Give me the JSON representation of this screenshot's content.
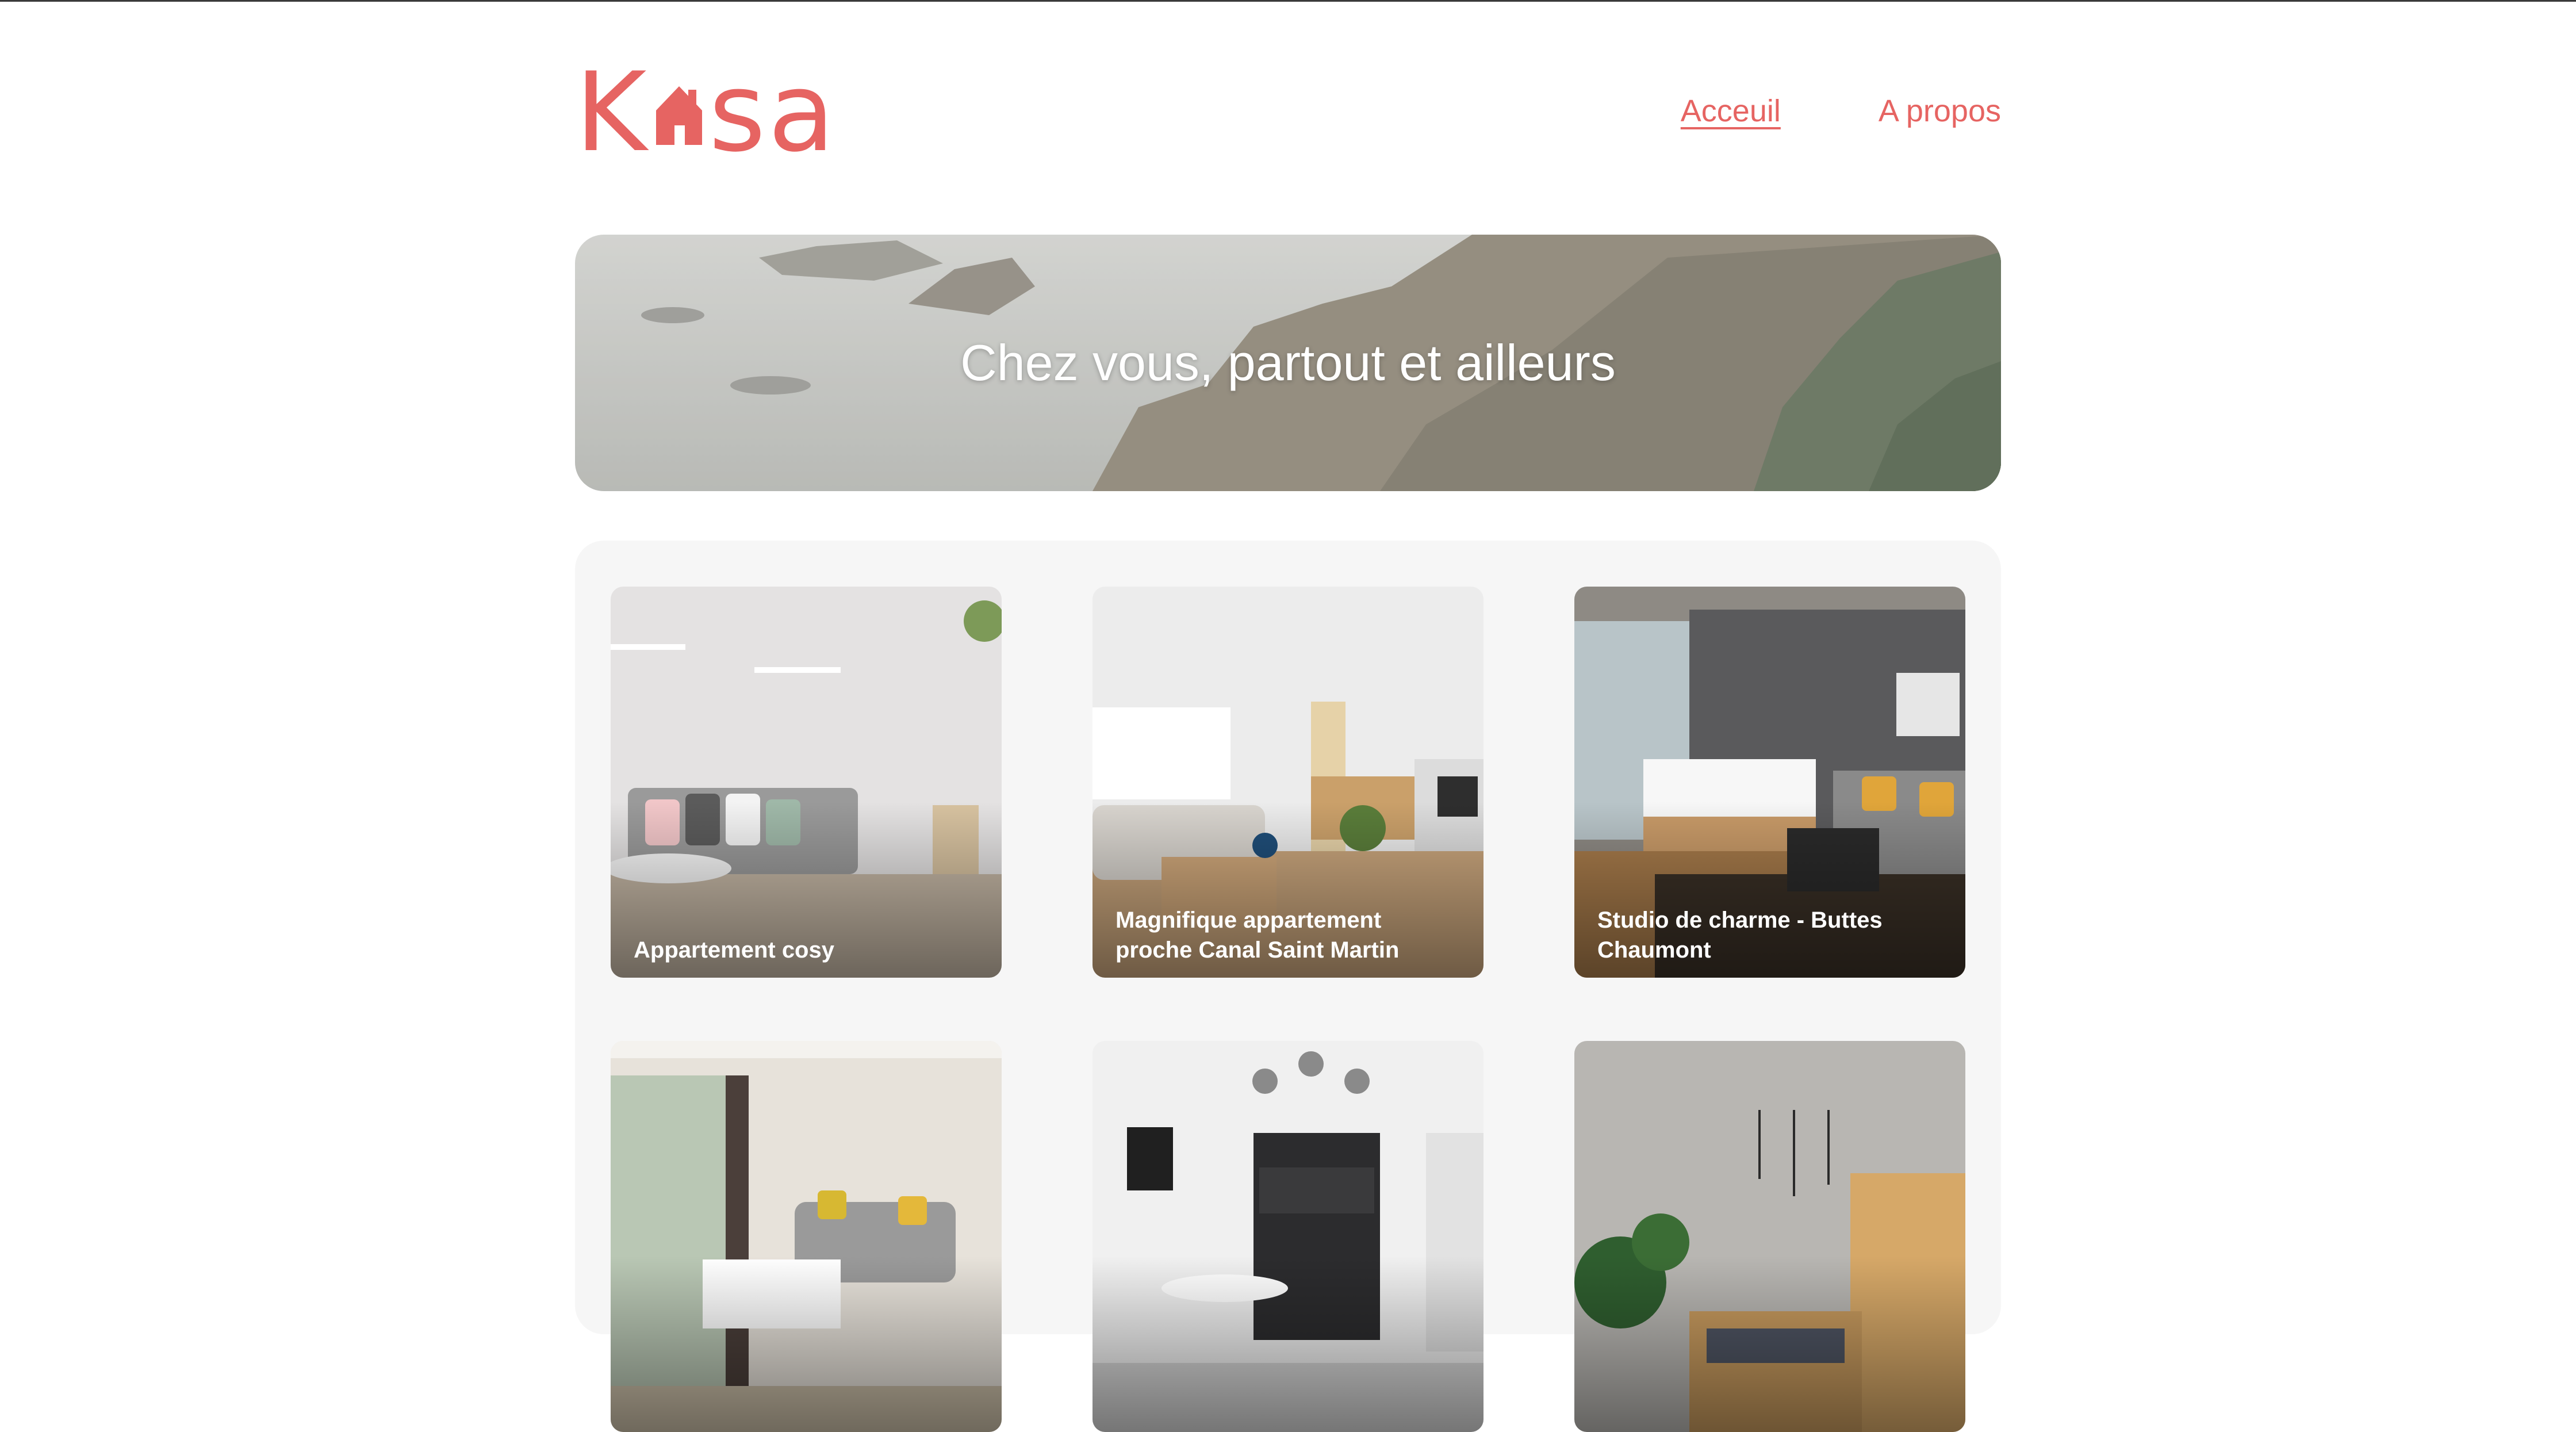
{
  "header": {
    "logo": {
      "part1": "K",
      "part2": "sa",
      "icon": "house-icon"
    },
    "nav": [
      {
        "label": "Acceuil",
        "active": true
      },
      {
        "label": "A propos",
        "active": false
      }
    ]
  },
  "banner": {
    "title": "Chez vous, partout et ailleurs"
  },
  "gallery": {
    "cards": [
      {
        "title": "Appartement cosy"
      },
      {
        "title": "Magnifique appartement proche Canal Saint Martin"
      },
      {
        "title": "Studio de charme - Buttes Chaumont"
      },
      {
        "title": ""
      },
      {
        "title": ""
      },
      {
        "title": ""
      }
    ]
  },
  "colors": {
    "brand": "#e66462",
    "gallery_bg": "#f6f6f6"
  }
}
